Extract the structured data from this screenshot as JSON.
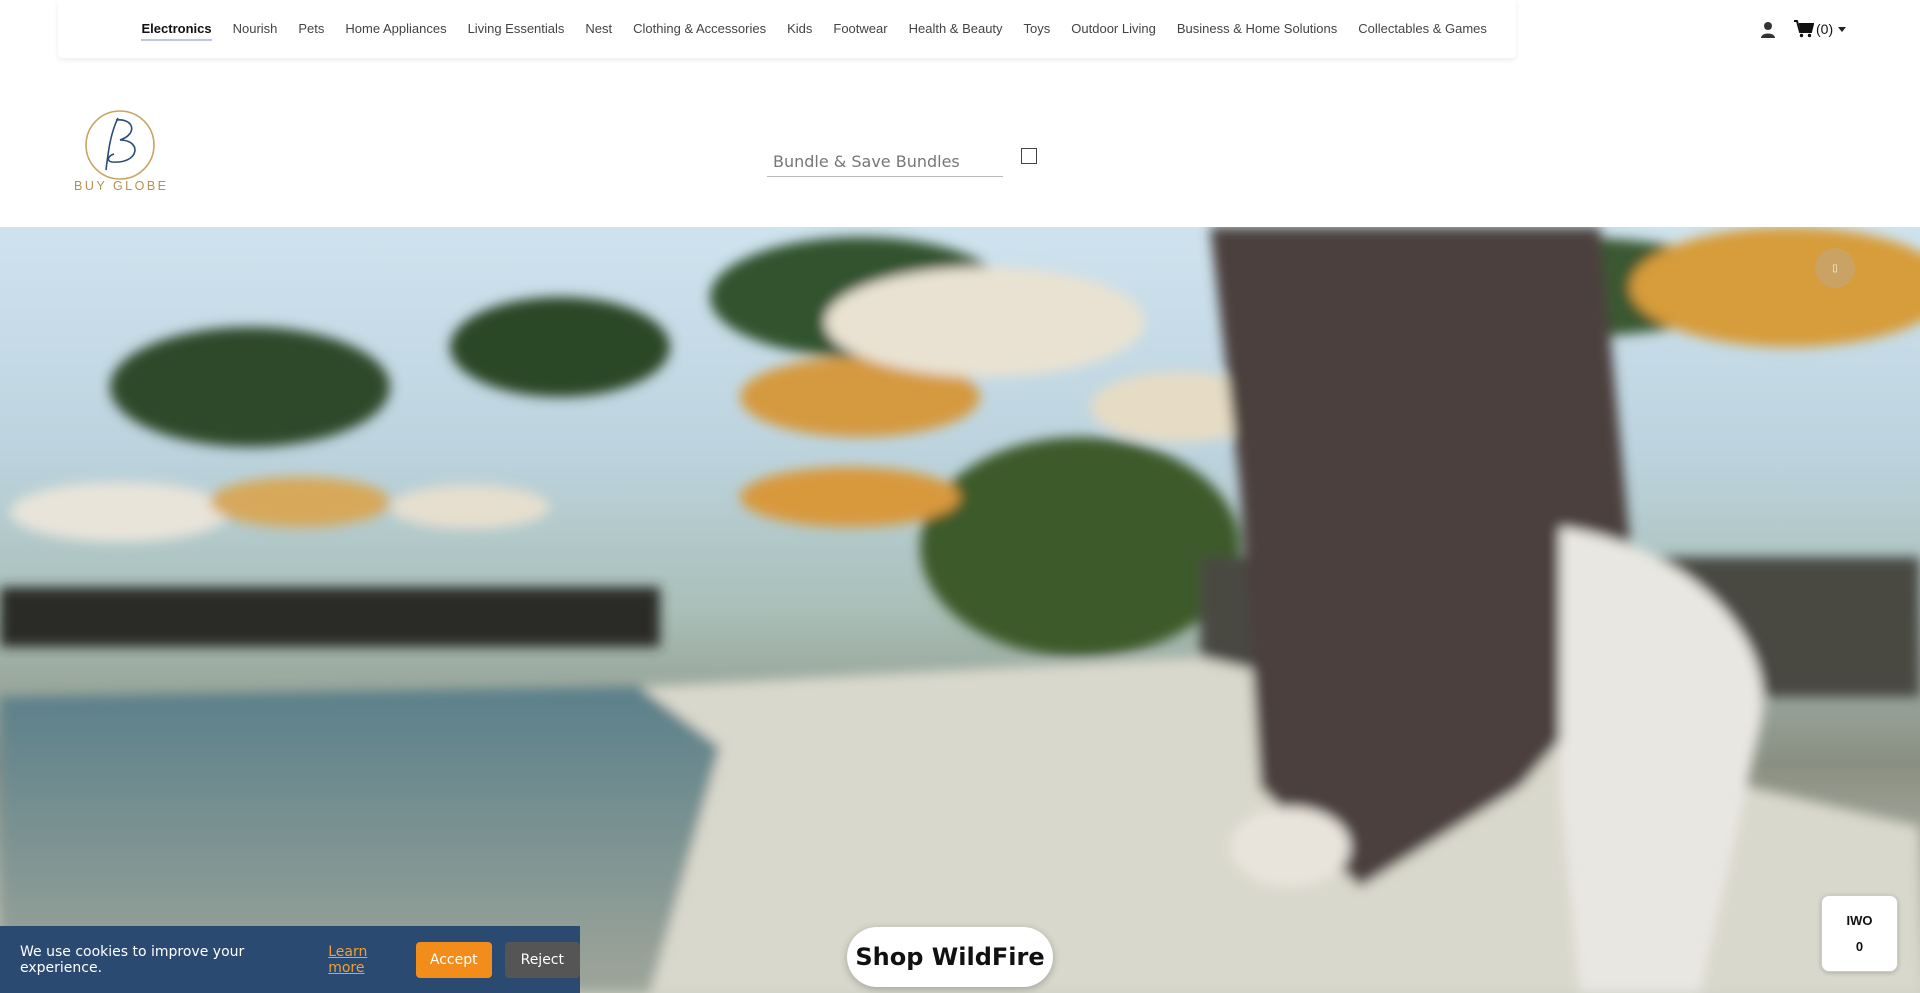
{
  "nav": {
    "items": [
      {
        "label": "Electronics",
        "active": true
      },
      {
        "label": "Nourish"
      },
      {
        "label": "Pets"
      },
      {
        "label": "Home Appliances"
      },
      {
        "label": "Living Essentials"
      },
      {
        "label": "Nest"
      },
      {
        "label": "Clothing & Accessories"
      },
      {
        "label": "Kids"
      },
      {
        "label": "Footwear"
      },
      {
        "label": "Health & Beauty"
      },
      {
        "label": "Toys"
      },
      {
        "label": "Outdoor Living"
      },
      {
        "label": "Business & Home Solutions"
      },
      {
        "label": "Collectables & Games"
      }
    ],
    "cart_count": "(0)",
    "icons": {
      "user": "user-icon",
      "cart": "cart-icon",
      "caret": "caret-down-icon"
    }
  },
  "logo": {
    "text": "BUY GLOBE",
    "color": "#b8904e"
  },
  "search": {
    "placeholder": "Bundle & Save Bundles",
    "value": ""
  },
  "hero": {
    "button_glyph": "▯",
    "cta_label": "Shop WildFire"
  },
  "cookie": {
    "message": "We use cookies to improve your experience.",
    "learn_more": "Learn more",
    "accept": "Accept",
    "reject": "Reject",
    "accent": "#f28d1c",
    "background": "#2a4a72"
  },
  "badge": {
    "line1": "IWO",
    "line2": "0"
  }
}
